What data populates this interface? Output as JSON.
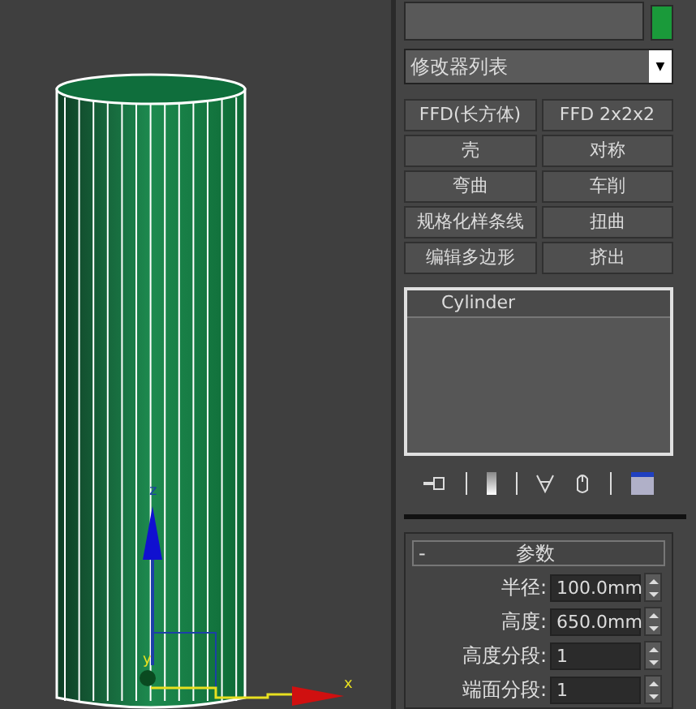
{
  "viewport": {
    "axes": [
      {
        "label": "z"
      },
      {
        "label": "y"
      },
      {
        "label": "x"
      }
    ]
  },
  "modifier_dropdown": {
    "value": "修改器列表",
    "arrow": "▼"
  },
  "modifier_buttons": [
    "FFD(长方体)",
    "FFD 2x2x2",
    "壳",
    "对称",
    "弯曲",
    "车削",
    "规格化样条线",
    "扭曲",
    "编辑多边形",
    "挤出"
  ],
  "stack": {
    "items": [
      {
        "label": "Cylinder",
        "selected": true
      }
    ]
  },
  "rollout": {
    "toggle": "-",
    "title": "参数",
    "params": [
      {
        "label": "半径:",
        "value": "100.0mm"
      },
      {
        "label": "高度:",
        "value": "650.0mm"
      },
      {
        "label": "高度分段:",
        "value": "1"
      },
      {
        "label": "端面分段:",
        "value": "1"
      }
    ]
  }
}
